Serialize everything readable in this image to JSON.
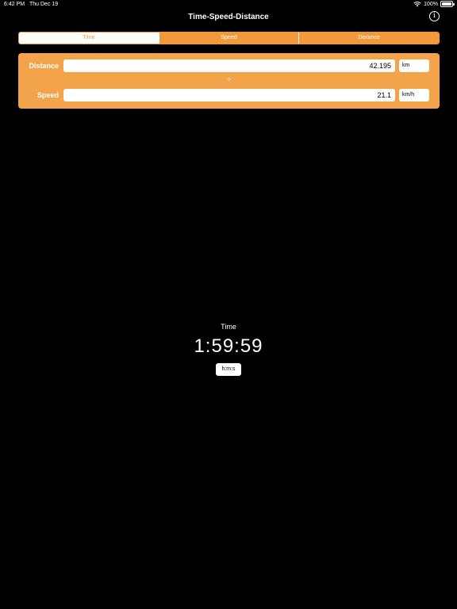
{
  "status_bar": {
    "time": "6:42 PM",
    "date": "Thu Dec 19",
    "battery": "100%"
  },
  "nav": {
    "title": "Time-Speed-Distance",
    "info_icon": "i"
  },
  "tabs": [
    {
      "label": "Time",
      "selected": true
    },
    {
      "label": "Speed",
      "selected": false
    },
    {
      "label": "Distance",
      "selected": false
    }
  ],
  "inputs": {
    "distance": {
      "label": "Distance",
      "value": "42.195",
      "unit": "km"
    },
    "operator": "÷",
    "speed": {
      "label": "Speed",
      "value": "21.1",
      "unit": "km/h"
    }
  },
  "result": {
    "label": "Time",
    "value": "1:59:59",
    "unit": "h:m:s"
  },
  "colors": {
    "accent": "#f19a3a",
    "panel": "#f3a44a",
    "background": "#000000"
  }
}
